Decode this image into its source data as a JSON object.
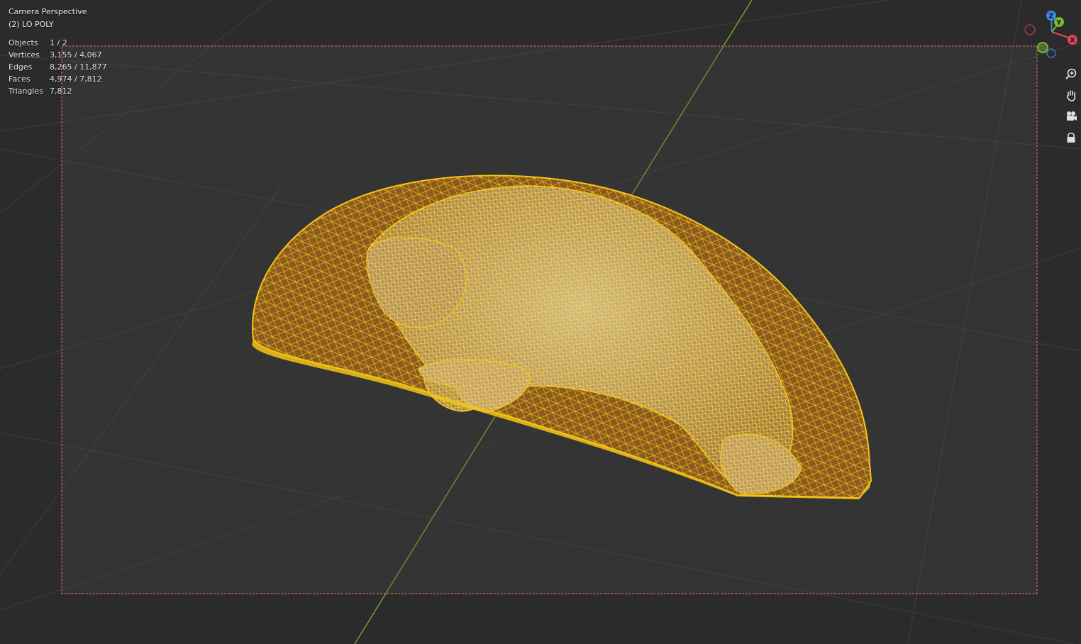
{
  "viewport": {
    "view_name": "Camera Perspective",
    "collection_object": "(2) LO POLY",
    "colors": {
      "background": "#2b2b2b",
      "grid": "#3a3a3a",
      "y_axis_line": "#6b9a2e",
      "camera_frame": "#e07a5f",
      "mesh_wire": "#f5c518",
      "mesh_fill": "#8a5a20"
    }
  },
  "stats": [
    {
      "label": "Objects",
      "value": "1 / 2"
    },
    {
      "label": "Vertices",
      "value": "3,155 / 4,067"
    },
    {
      "label": "Edges",
      "value": "8,265 / 11,877"
    },
    {
      "label": "Faces",
      "value": "4,974 / 7,812"
    },
    {
      "label": "Triangles",
      "value": "7,812"
    }
  ],
  "gizmo": {
    "axes": [
      {
        "name": "X",
        "color": "#e0455a"
      },
      {
        "name": "Y",
        "color": "#7cb431"
      },
      {
        "name": "Z",
        "color": "#3d87e0"
      }
    ]
  },
  "nav_tools": [
    {
      "name": "zoom",
      "icon": "zoom-icon"
    },
    {
      "name": "pan",
      "icon": "hand-icon"
    },
    {
      "name": "camera-view",
      "icon": "camera-icon"
    },
    {
      "name": "lock-camera",
      "icon": "lock-icon"
    }
  ]
}
